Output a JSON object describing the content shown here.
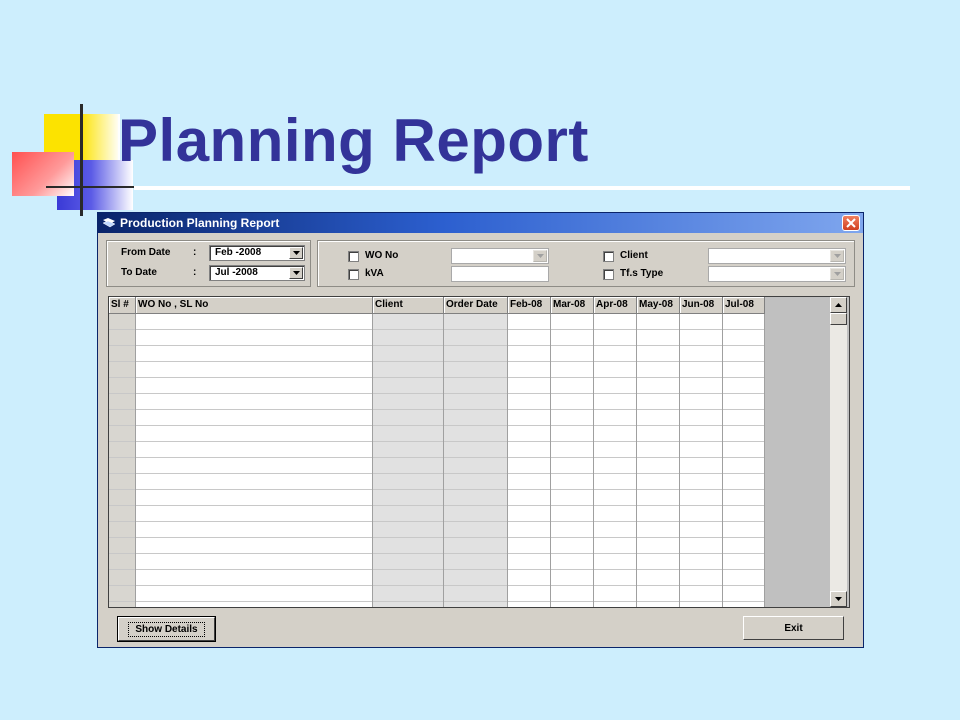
{
  "slide": {
    "title": "Planning Report"
  },
  "window": {
    "title": "Production Planning Report",
    "close_icon": "close-icon"
  },
  "date_range": {
    "from_label": "From Date",
    "from_sep": ":",
    "from_value": "Feb -2008",
    "to_label": "To Date",
    "to_sep": ":",
    "to_value": "Jul -2008"
  },
  "filters": {
    "wo_no_label": "WO No",
    "wo_no_checked": false,
    "kva_label": "kVA",
    "kva_checked": false,
    "client_label": "Client",
    "client_checked": false,
    "tfs_type_label": "Tf.s Type",
    "tfs_type_checked": false
  },
  "grid": {
    "columns": [
      "Sl #",
      "WO No , SL No",
      "Client",
      "Order Date",
      "Feb-08",
      "Mar-08",
      "Apr-08",
      "May-08",
      "Jun-08",
      "Jul-08"
    ],
    "rows": []
  },
  "buttons": {
    "show_details": "Show Details",
    "exit": "Exit"
  },
  "colors": {
    "slide_background": "#cdeefd",
    "title": "#333399",
    "window_face": "#d4d0c8",
    "titlebar_start": "#0a246a"
  }
}
